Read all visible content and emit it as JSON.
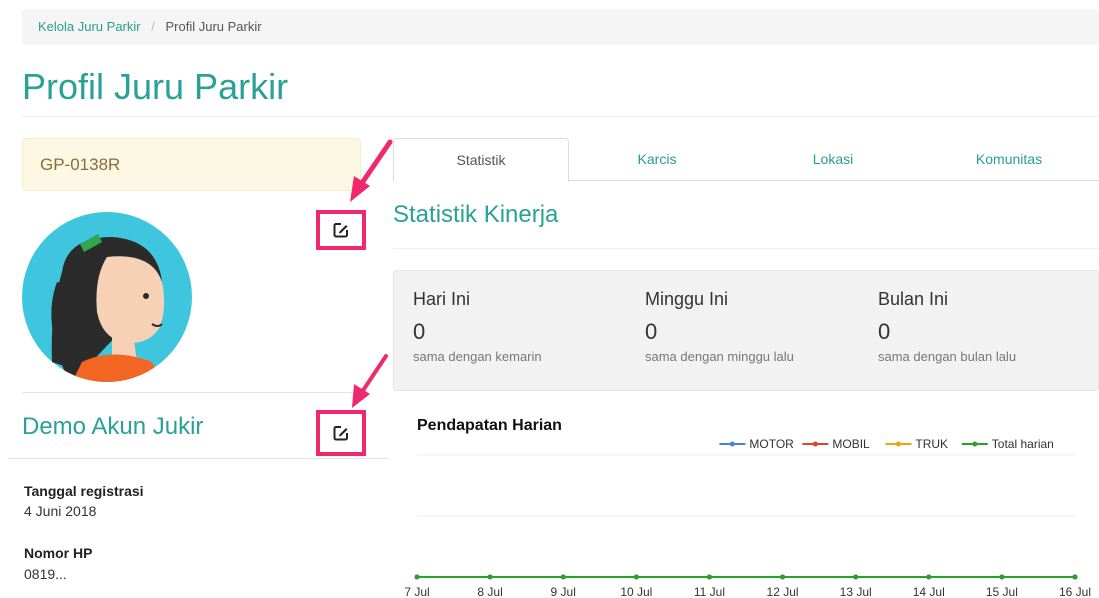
{
  "breadcrumb": {
    "parent": "Kelola Juru Parkir",
    "separator": "/",
    "current": "Profil Juru Parkir"
  },
  "page_title": "Profil Juru Parkir",
  "profile": {
    "code": "GP-0138R",
    "name": "Demo Akun Jukir",
    "registration_label": "Tanggal registrasi",
    "registration_value": "4 Juni 2018",
    "phone_label": "Nomor HP",
    "phone_value": "0819..."
  },
  "tabs": [
    {
      "label": "Statistik",
      "active": true
    },
    {
      "label": "Karcis",
      "active": false
    },
    {
      "label": "Lokasi",
      "active": false
    },
    {
      "label": "Komunitas",
      "active": false
    }
  ],
  "section_title": "Statistik Kinerja",
  "stats": [
    {
      "label": "Hari Ini",
      "value": "0",
      "compare": "sama dengan kemarin"
    },
    {
      "label": "Minggu Ini",
      "value": "0",
      "compare": "sama dengan minggu lalu"
    },
    {
      "label": "Bulan Ini",
      "value": "0",
      "compare": "sama dengan bulan lalu"
    }
  ],
  "colors": {
    "accent": "#2aa198",
    "highlight": "#f0286e",
    "motor": "#4f7fd6",
    "mobil": "#e0452b",
    "truk": "#f0a30a",
    "total": "#2ca02c"
  },
  "icons": {
    "edit": "edit-square-icon",
    "arrow": "pointer-arrow-icon"
  },
  "chart_data": {
    "type": "line",
    "title": "Pendapatan Harian",
    "x": [
      "7 Jul",
      "8 Jul",
      "9 Jul",
      "10 Jul",
      "11 Jul",
      "12 Jul",
      "13 Jul",
      "14 Jul",
      "15 Jul",
      "16 Jul"
    ],
    "series": [
      {
        "name": "MOTOR",
        "color": "#4f7fd6",
        "values": [
          0,
          0,
          0,
          0,
          0,
          0,
          0,
          0,
          0,
          0
        ]
      },
      {
        "name": "MOBIL",
        "color": "#e0452b",
        "values": [
          0,
          0,
          0,
          0,
          0,
          0,
          0,
          0,
          0,
          0
        ]
      },
      {
        "name": "TRUK",
        "color": "#f0a30a",
        "values": [
          0,
          0,
          0,
          0,
          0,
          0,
          0,
          0,
          0,
          0
        ]
      },
      {
        "name": "Total harian",
        "color": "#2ca02c",
        "values": [
          0,
          0,
          0,
          0,
          0,
          0,
          0,
          0,
          0,
          0
        ]
      }
    ],
    "ylim": [
      0,
      1
    ],
    "grid": true,
    "legend": "top-right"
  }
}
